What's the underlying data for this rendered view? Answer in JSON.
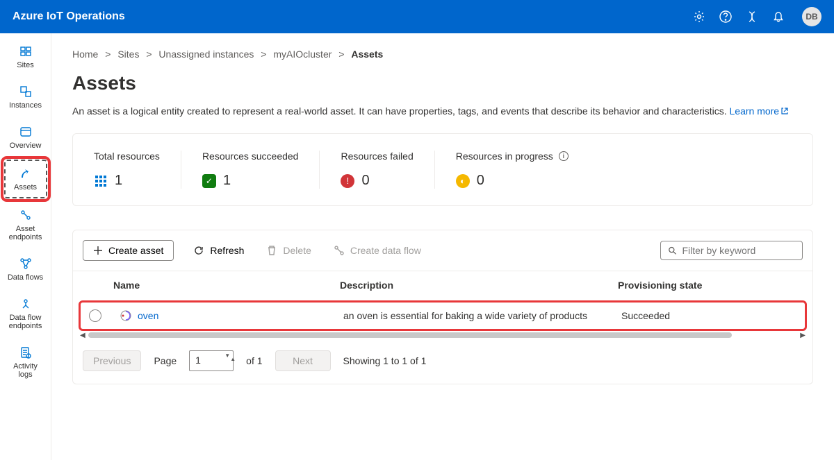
{
  "header": {
    "title": "Azure IoT Operations",
    "avatar": "DB"
  },
  "sidebar": {
    "items": [
      {
        "label": "Sites"
      },
      {
        "label": "Instances"
      },
      {
        "label": "Overview"
      },
      {
        "label": "Assets"
      },
      {
        "label": "Asset endpoints"
      },
      {
        "label": "Data flows"
      },
      {
        "label": "Data flow endpoints"
      },
      {
        "label": "Activity logs"
      }
    ]
  },
  "breadcrumb": {
    "items": [
      "Home",
      "Sites",
      "Unassigned instances",
      "myAIOcluster"
    ],
    "current": "Assets"
  },
  "page": {
    "title": "Assets",
    "description": "An asset is a logical entity created to represent a real-world asset. It can have properties, tags, and events that describe its behavior and characteristics. ",
    "learnMore": "Learn more"
  },
  "stats": {
    "total": {
      "label": "Total resources",
      "value": "1"
    },
    "succeeded": {
      "label": "Resources succeeded",
      "value": "1"
    },
    "failed": {
      "label": "Resources failed",
      "value": "0"
    },
    "inprogress": {
      "label": "Resources in progress",
      "value": "0"
    }
  },
  "toolbar": {
    "create": "Create asset",
    "refresh": "Refresh",
    "delete": "Delete",
    "dataflow": "Create data flow",
    "filterPlaceholder": "Filter by keyword"
  },
  "table": {
    "columns": {
      "name": "Name",
      "description": "Description",
      "state": "Provisioning state"
    },
    "rows": [
      {
        "name": "oven",
        "description": "an oven is essential for baking a wide variety of products",
        "state": "Succeeded"
      }
    ]
  },
  "pager": {
    "previous": "Previous",
    "next": "Next",
    "pageLabel": "Page",
    "pageValue": "1",
    "ofLabel": "of 1",
    "showing": "Showing 1 to 1 of 1"
  }
}
